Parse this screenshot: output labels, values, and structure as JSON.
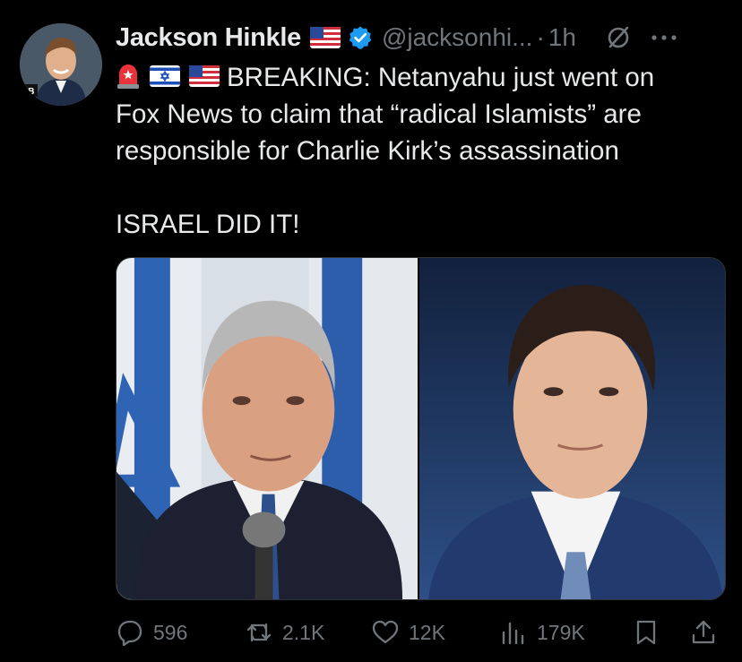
{
  "author": {
    "display_name": "Jackson Hinkle",
    "handle": "@jacksonhi...",
    "separator": "·",
    "time": "1h",
    "avatar_monogram": "HB"
  },
  "tweet": {
    "line1": "BREAKING: Netanyahu just went on",
    "line2": "Fox News to claim that “radical Islamists” are",
    "line3": "responsible for Charlie Kirk’s assassination",
    "line4": "ISRAEL DID IT!"
  },
  "icons": {
    "verified": "verified-badge-icon",
    "flag": "us-flag-icon",
    "siren": "siren-icon",
    "israel_flag": "israel-flag-icon",
    "grok": "grok-icon",
    "more": "more-icon",
    "reply": "reply-icon",
    "repost": "repost-icon",
    "like": "heart-icon",
    "views": "views-icon",
    "bookmark": "bookmark-icon",
    "share": "share-icon"
  },
  "stats": {
    "replies": "596",
    "reposts": "2.1K",
    "likes": "12K",
    "views": "179K"
  },
  "colors": {
    "background": "#000000",
    "text": "#e7e9ea",
    "secondary": "#71767b",
    "verified_blue": "#1d9bf0"
  }
}
